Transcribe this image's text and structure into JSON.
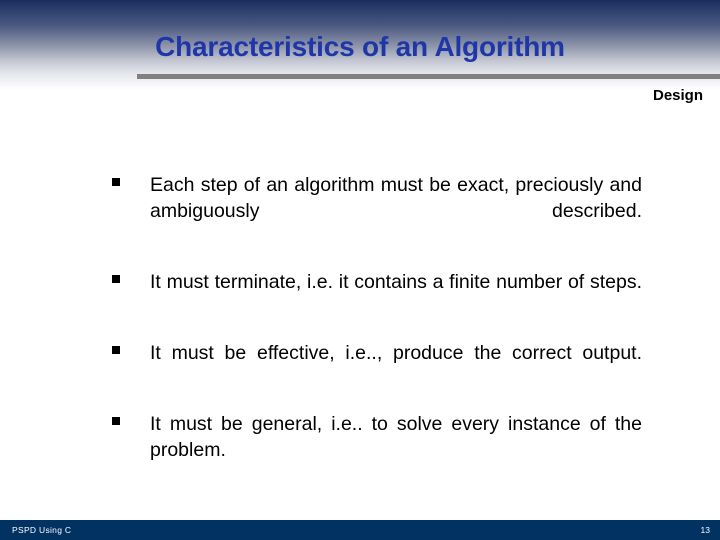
{
  "slide": {
    "title": "Characteristics of an Algorithm",
    "subtitle": "Design",
    "title_color": "#1f36a8",
    "rule_color": "#808080",
    "header_top_color": "#1b2d5c",
    "footer_color": "#023262",
    "bullets": [
      {
        "marker": "square-bullet",
        "text": "Each step of an algorithm must be exact, preciously and ambiguously described."
      },
      {
        "marker": "square-bullet",
        "text": "It must terminate, i.e. it contains a finite number of steps."
      },
      {
        "marker": "square-bullet",
        "text": "It must be effective, i.e.., produce the correct output."
      },
      {
        "marker": "square-bullet",
        "text": "It must be general, i.e.. to solve every instance of the  problem."
      }
    ]
  },
  "footer": {
    "left_label": "PSPD Using C",
    "page_number": "13"
  }
}
